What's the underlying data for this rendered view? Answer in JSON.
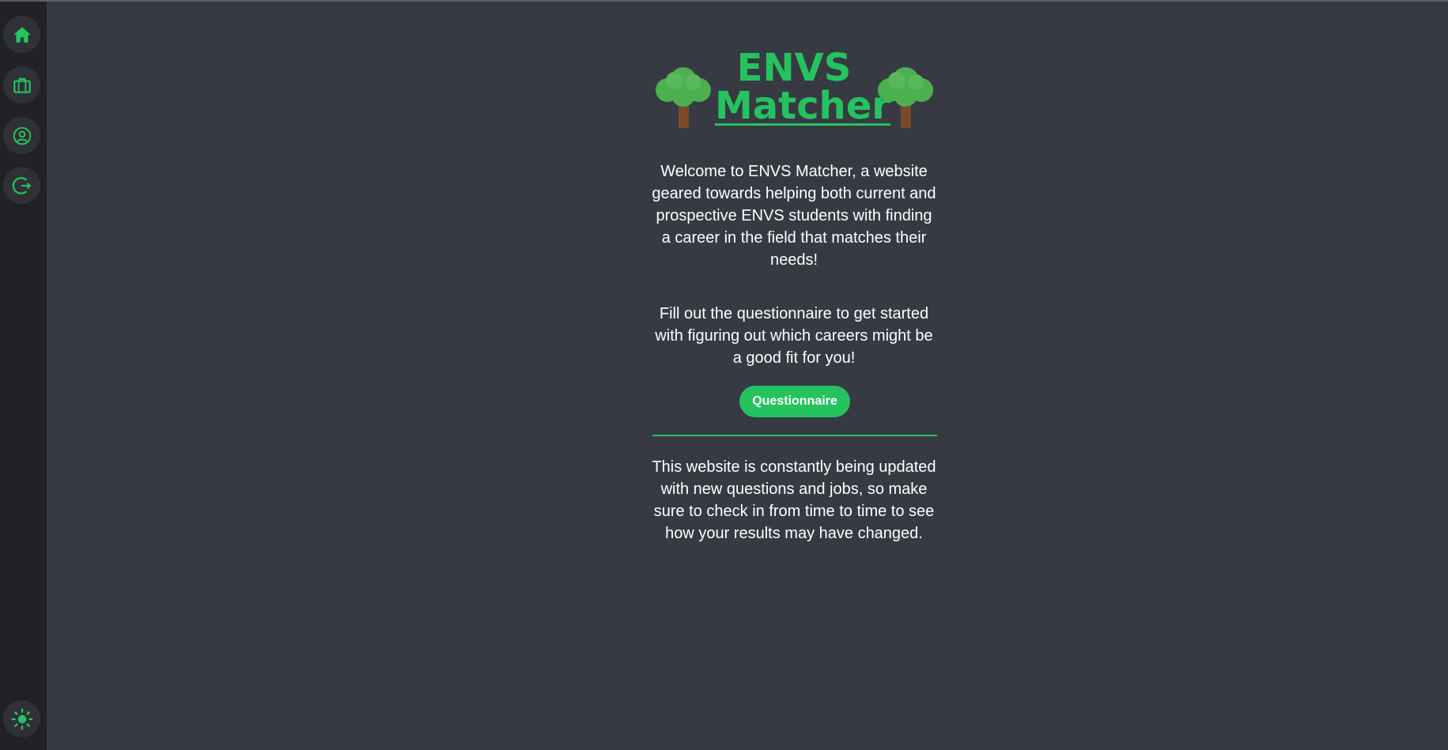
{
  "app": {
    "title_line1": "ENVS",
    "title_line2": "Matcher"
  },
  "sidebar": {
    "items": [
      {
        "name": "home",
        "icon": "home-icon"
      },
      {
        "name": "jobs",
        "icon": "briefcase-icon"
      },
      {
        "name": "profile",
        "icon": "user-circle-icon"
      },
      {
        "name": "logout",
        "icon": "logout-icon"
      }
    ],
    "theme_toggle": {
      "icon": "sun-icon"
    }
  },
  "content": {
    "intro": "Welcome to ENVS Matcher, a website geared towards helping both current and prospective ENVS students with finding a career in the field that matches their needs!",
    "cta_text": "Fill out the questionnaire to get started with figuring out which careers might be a good fit for you!",
    "button_label": "Questionnaire",
    "footer_note": "This website is constantly being updated with new questions and jobs, so make sure to check in from time to time to see how your results may have changed."
  },
  "colors": {
    "accent": "#24c35f",
    "background": "#373a42",
    "sidebar": "#202225",
    "tree_foliage": "#4caf50",
    "tree_trunk": "#7a4a2a"
  }
}
